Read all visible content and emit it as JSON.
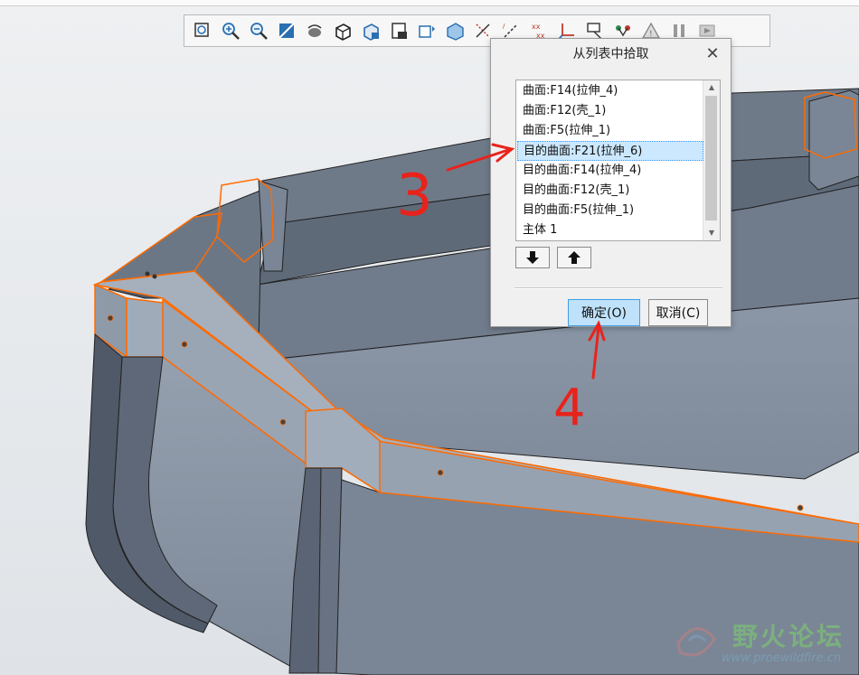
{
  "toolbar": {
    "buttons": [
      {
        "name": "zoom-fit-icon"
      },
      {
        "name": "zoom-in-icon"
      },
      {
        "name": "zoom-out-icon"
      },
      {
        "name": "repaint-icon"
      },
      {
        "name": "spin-center-icon"
      },
      {
        "name": "shaded-cube-icon"
      },
      {
        "name": "named-views-icon"
      },
      {
        "name": "saved-orientations-icon"
      },
      {
        "name": "display-style-icon"
      },
      {
        "name": "perspective-icon"
      },
      {
        "name": "datum-plane-icon"
      },
      {
        "name": "datum-axis-icon"
      },
      {
        "name": "datum-point-icon"
      },
      {
        "name": "csys-icon"
      },
      {
        "name": "annotation-icon"
      },
      {
        "name": "spin-display-icon"
      },
      {
        "name": "warning-icon"
      },
      {
        "name": "pause-icon"
      },
      {
        "name": "regenerate-icon"
      }
    ]
  },
  "dialog": {
    "title": "从列表中拾取",
    "close": "✕",
    "items": [
      {
        "label": "曲面:F14(拉伸_4)",
        "selected": false
      },
      {
        "label": "曲面:F12(壳_1)",
        "selected": false
      },
      {
        "label": "曲面:F5(拉伸_1)",
        "selected": false
      },
      {
        "label": "目的曲面:F21(拉伸_6)",
        "selected": true
      },
      {
        "label": "目的曲面:F14(拉伸_4)",
        "selected": false
      },
      {
        "label": "目的曲面:F12(壳_1)",
        "selected": false
      },
      {
        "label": "目的曲面:F5(拉伸_1)",
        "selected": false
      },
      {
        "label": "主体 1",
        "selected": false
      }
    ],
    "ok_label": "确定(O)",
    "cancel_label": "取消(C)"
  },
  "annotations": {
    "step3": "3",
    "step4": "4",
    "color": "#e8231c"
  },
  "watermark": {
    "title": "野火论坛",
    "url": "www.proewildfire.cn"
  },
  "colors": {
    "highlight": "#ff6a00",
    "model": "#8a96a6",
    "selection": "#cce8ff"
  }
}
